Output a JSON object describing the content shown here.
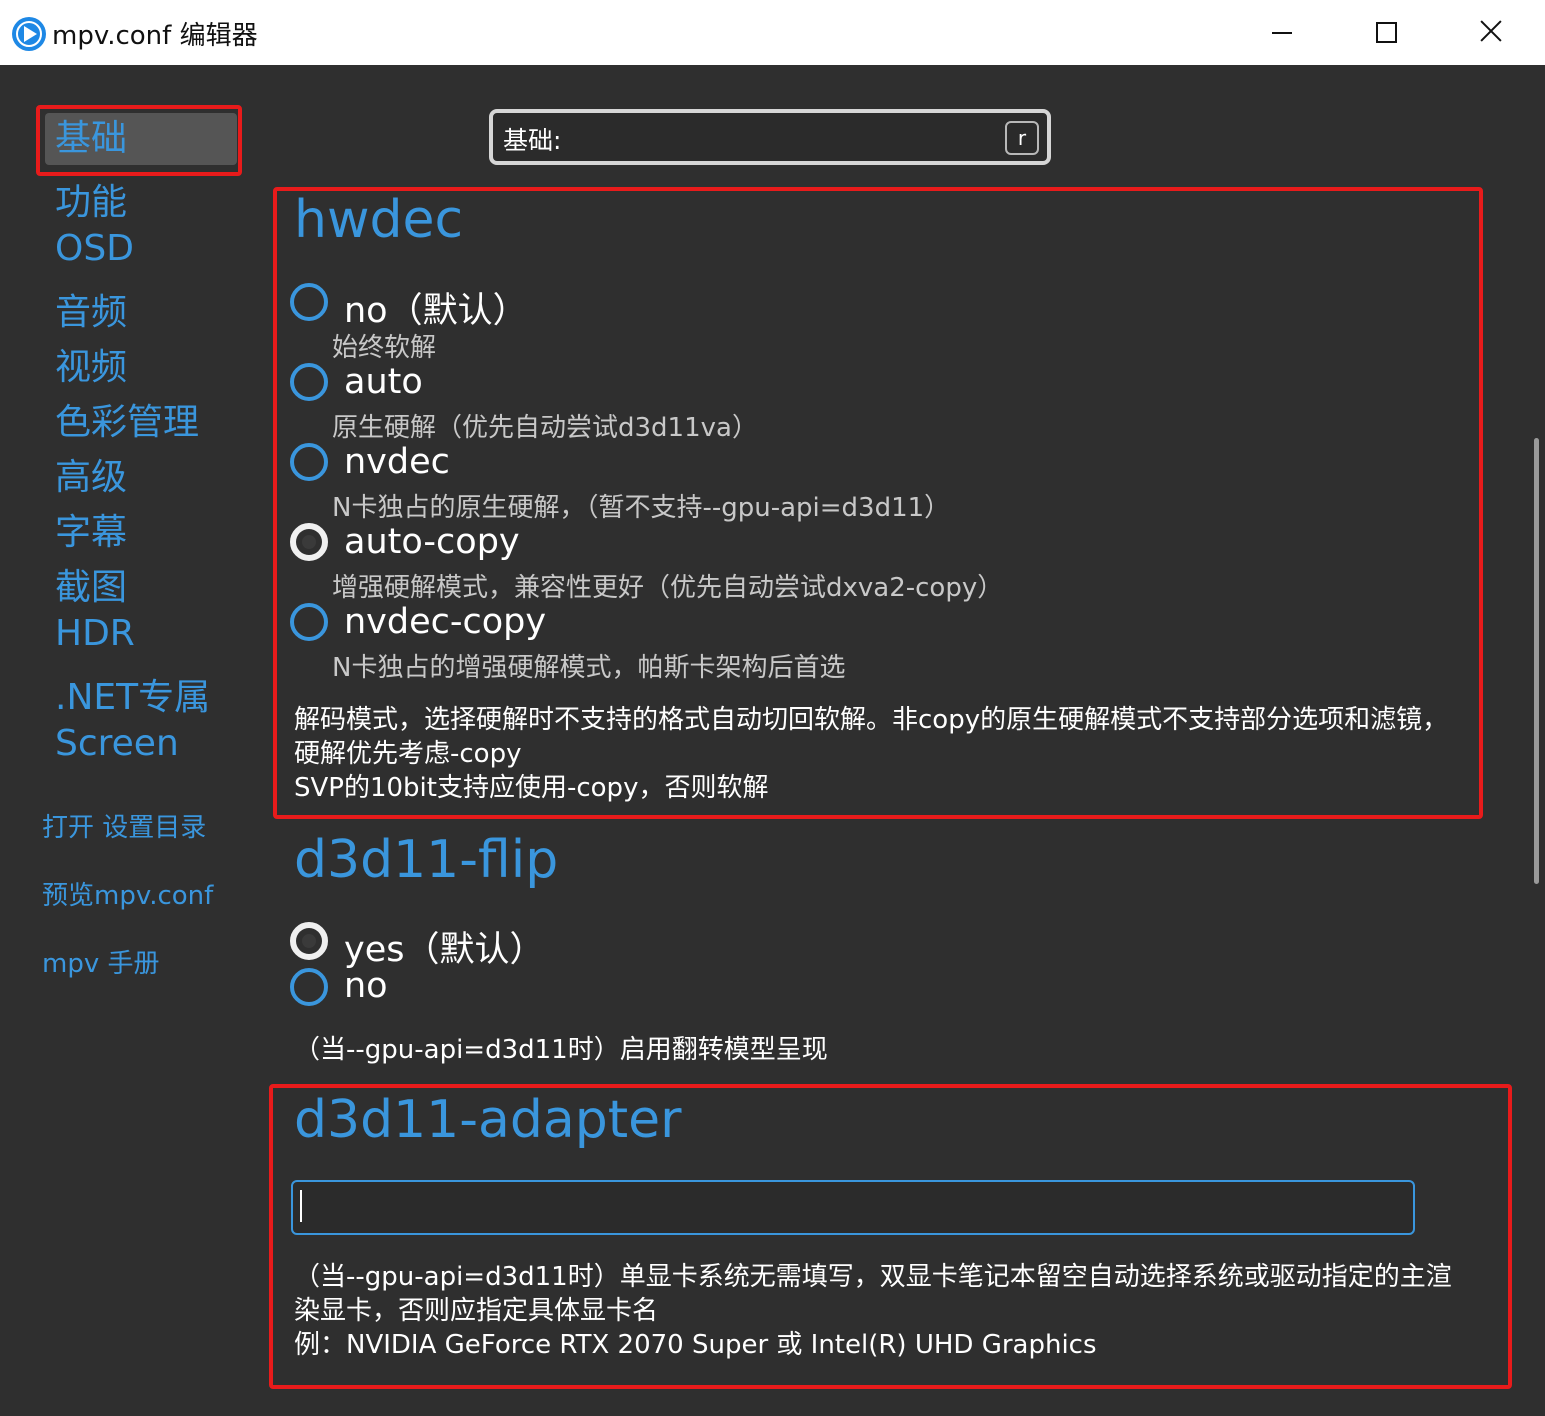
{
  "window": {
    "title": "mpv.conf 编辑器"
  },
  "sidebar": {
    "items": [
      {
        "label": "基础",
        "active": true
      },
      {
        "label": "功能"
      },
      {
        "label": "OSD"
      },
      {
        "label": "音频"
      },
      {
        "label": "视频"
      },
      {
        "label": "色彩管理"
      },
      {
        "label": "高级"
      },
      {
        "label": "字幕"
      },
      {
        "label": "截图"
      },
      {
        "label": "HDR"
      },
      {
        "label": ".NET专属"
      },
      {
        "label": "Screen"
      }
    ],
    "links": [
      {
        "label": "打开 设置目录"
      },
      {
        "label": "预览mpv.conf"
      },
      {
        "label": "mpv 手册"
      }
    ]
  },
  "search": {
    "value": "基础:",
    "key_hint": "r"
  },
  "sections": {
    "hwdec": {
      "title": "hwdec",
      "options": [
        {
          "label": "no（默认）",
          "desc": "始终软解",
          "checked": false
        },
        {
          "label": "auto",
          "desc": "原生硬解（优先自动尝试d3d11va）",
          "checked": false
        },
        {
          "label": "nvdec",
          "desc": "N卡独占的原生硬解，（暂不支持--gpu-api=d3d11）",
          "checked": false
        },
        {
          "label": "auto-copy",
          "desc": "增强硬解模式，兼容性更好（优先自动尝试dxva2-copy）",
          "checked": true
        },
        {
          "label": "nvdec-copy",
          "desc": "N卡独占的增强硬解模式，帕斯卡架构后首选",
          "checked": false
        }
      ],
      "help": [
        "解码模式，选择硬解时不支持的格式自动切回软解。非copy的原生硬解模式不支持部分选项和滤镜，",
        "硬解优先考虑-copy",
        "SVP的10bit支持应使用-copy，否则软解"
      ]
    },
    "d3d11_flip": {
      "title": "d3d11-flip",
      "options": [
        {
          "label": "yes（默认）",
          "checked": true
        },
        {
          "label": "no",
          "checked": false
        }
      ],
      "help": "（当--gpu-api=d3d11时）启用翻转模型呈现"
    },
    "d3d11_adapter": {
      "title": "d3d11-adapter",
      "value": "",
      "help": [
        "（当--gpu-api=d3d11时）单显卡系统无需填写，双显卡笔记本留空自动选择系统或驱动指定的主渲",
        "染显卡，否则应指定具体显卡名",
        "例：NVIDIA GeForce RTX 2070 Super 或 Intel(R) UHD Graphics"
      ]
    }
  },
  "colors": {
    "accent": "#3a96dd",
    "highlight": "#e81b1b",
    "background": "#2f2f2f"
  }
}
